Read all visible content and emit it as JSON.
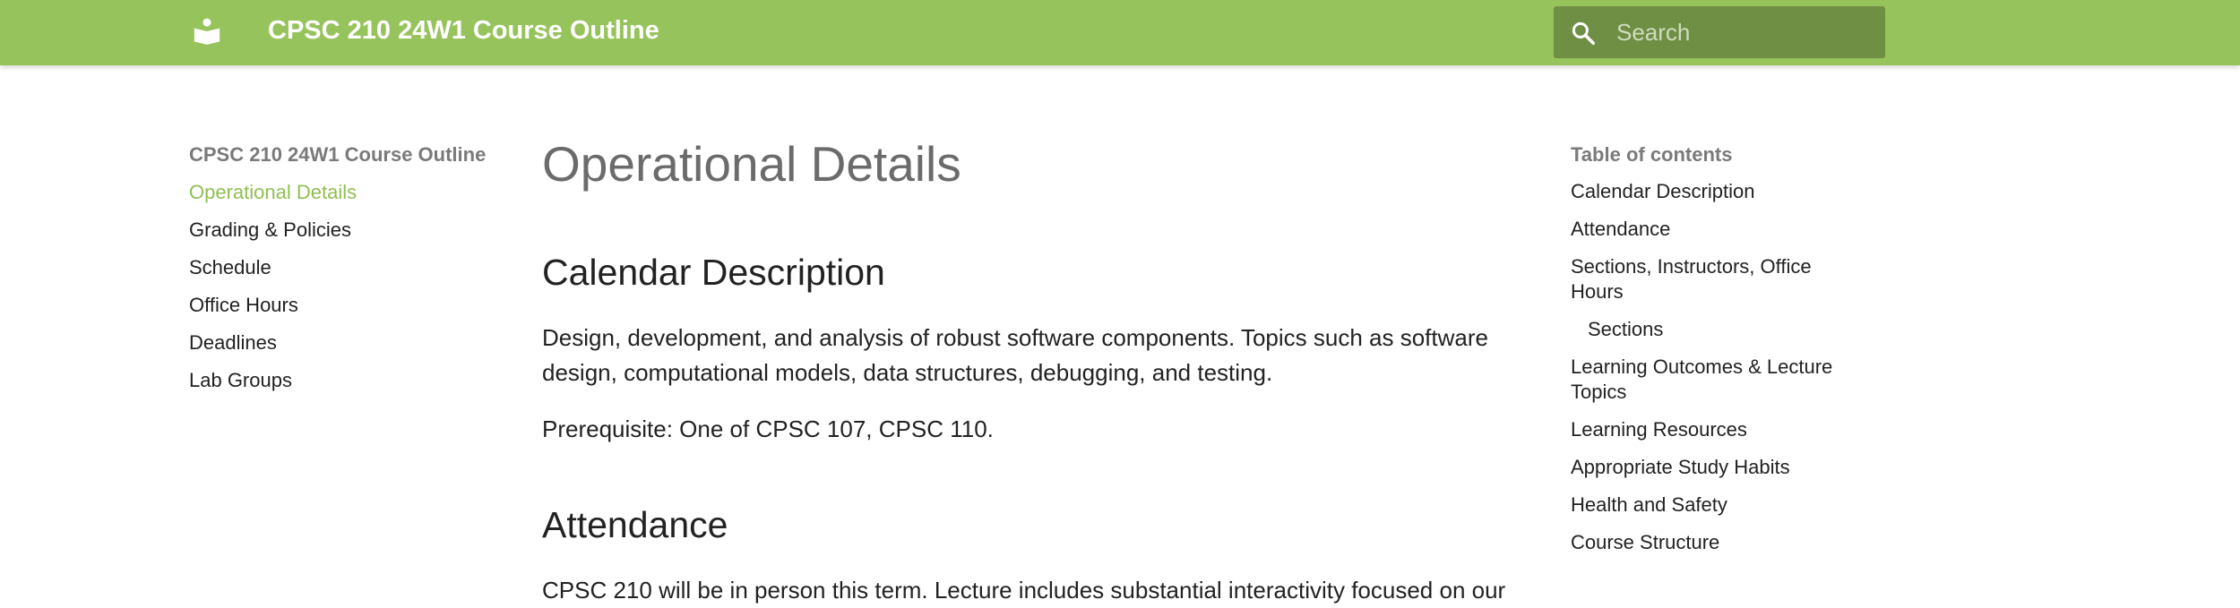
{
  "header": {
    "title": "CPSC 210 24W1 Course Outline",
    "logo_icon": "book-reader-icon",
    "search_placeholder": "Search",
    "search_value": "",
    "search_icon": "search-icon",
    "bar_color": "#97c35c",
    "search_bg_color": "#6f8f44"
  },
  "nav": {
    "title": "CPSC 210 24W1 Course Outline",
    "items": [
      {
        "label": "Operational Details",
        "active": true
      },
      {
        "label": "Grading & Policies",
        "active": false
      },
      {
        "label": "Schedule",
        "active": false
      },
      {
        "label": "Office Hours",
        "active": false
      },
      {
        "label": "Deadlines",
        "active": false
      },
      {
        "label": "Lab Groups",
        "active": false
      }
    ],
    "active_color": "#8fbf52"
  },
  "main": {
    "page_title": "Operational Details",
    "sections": [
      {
        "heading": "Calendar Description",
        "paragraphs": [
          "Design, development, and analysis of robust software components. Topics such as software design, computational models, data structures, debugging, and testing.",
          "Prerequisite: One of CPSC 107, CPSC 110."
        ]
      },
      {
        "heading": "Attendance",
        "paragraphs": [
          "CPSC 210 will be in person this term. Lecture includes substantial interactivity focused on our"
        ]
      }
    ]
  },
  "toc": {
    "title": "Table of contents",
    "items": [
      {
        "label": "Calendar Description",
        "indent": 0
      },
      {
        "label": "Attendance",
        "indent": 0
      },
      {
        "label": "Sections, Instructors, Office Hours",
        "indent": 0
      },
      {
        "label": "Sections",
        "indent": 1
      },
      {
        "label": "Learning Outcomes & Lecture Topics",
        "indent": 0
      },
      {
        "label": "Learning Resources",
        "indent": 0
      },
      {
        "label": "Appropriate Study Habits",
        "indent": 0
      },
      {
        "label": "Health and Safety",
        "indent": 0
      },
      {
        "label": "Course Structure",
        "indent": 0
      }
    ]
  }
}
